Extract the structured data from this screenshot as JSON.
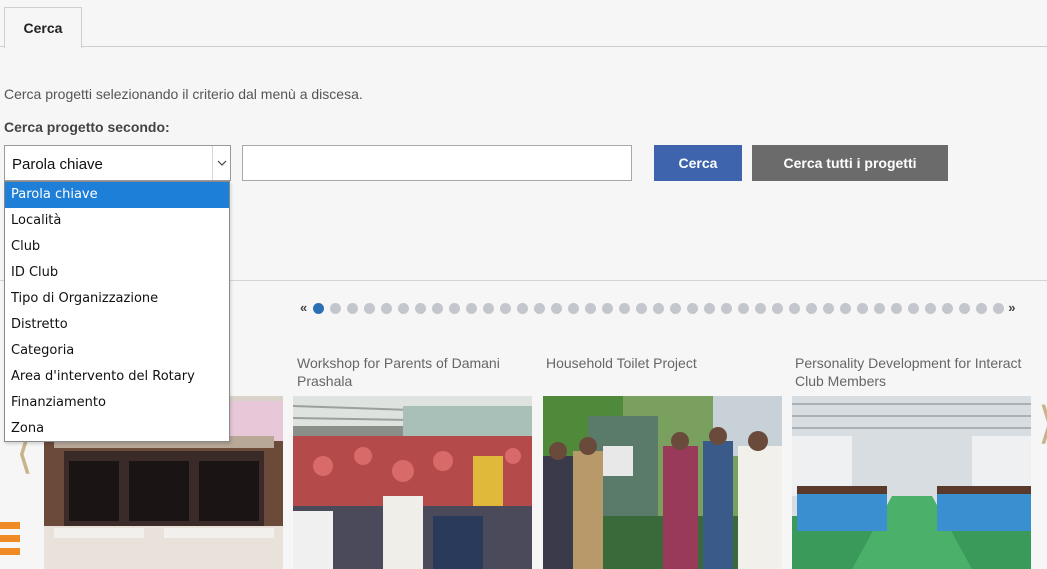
{
  "tabs": [
    {
      "label": "Cerca"
    }
  ],
  "search": {
    "intro_text": "Cerca progetti selezionando il criterio dal menù a discesa.",
    "criteria_label": "Cerca progetto secondo:",
    "selected_criterion": "Parola chiave",
    "keyword_value": "",
    "search_button": "Cerca",
    "search_all_button": "Cerca tutti i progetti",
    "options": [
      "Parola chiave",
      "Località",
      "Club",
      "ID Club",
      "Tipo di Organizzazione",
      "Distretto",
      "Categoria",
      "Area d'intervento del Rotary",
      "Finanziamento",
      "Zona"
    ]
  },
  "carousel": {
    "prev_page": "«",
    "next_page": "»",
    "page_count": 41,
    "active_page": 1,
    "prev_arrow": "⟨",
    "next_arrow": "⟩",
    "cards": [
      {
        "title": ""
      },
      {
        "title": "Workshop for Parents of Damani Prashala"
      },
      {
        "title": "Household Toilet Project"
      },
      {
        "title": "Personality Development for Interact Club Members"
      }
    ]
  },
  "colors": {
    "primary_button": "#3d64ad",
    "secondary_button": "#6b6b6b",
    "dropdown_selected": "#1e7fd9",
    "active_dot": "#2d6fb5",
    "accent_orange": "#f08a24"
  },
  "icons": {
    "select_arrow": "chevron-down-icon"
  }
}
